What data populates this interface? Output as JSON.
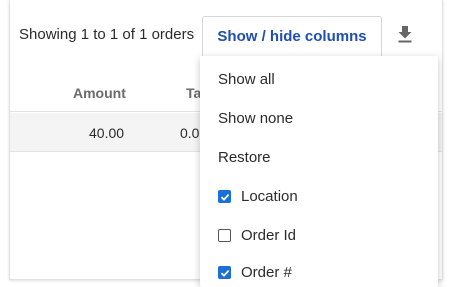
{
  "toolbar": {
    "showing_text": "Showing 1 to 1 of 1 orders",
    "columns_button_label": "Show / hide columns",
    "download_icon": "download-icon"
  },
  "table": {
    "headers": [
      "Amount",
      "Ta"
    ],
    "rows": [
      [
        "40.00",
        "0.0"
      ]
    ]
  },
  "menu": {
    "actions": [
      "Show all",
      "Show none",
      "Restore"
    ],
    "columns": [
      {
        "label": "Location",
        "checked": true
      },
      {
        "label": "Order Id",
        "checked": false
      },
      {
        "label": "Order #",
        "checked": true
      }
    ]
  },
  "colors": {
    "accent": "#1f4fb0",
    "checkbox": "#1a6fd8"
  }
}
